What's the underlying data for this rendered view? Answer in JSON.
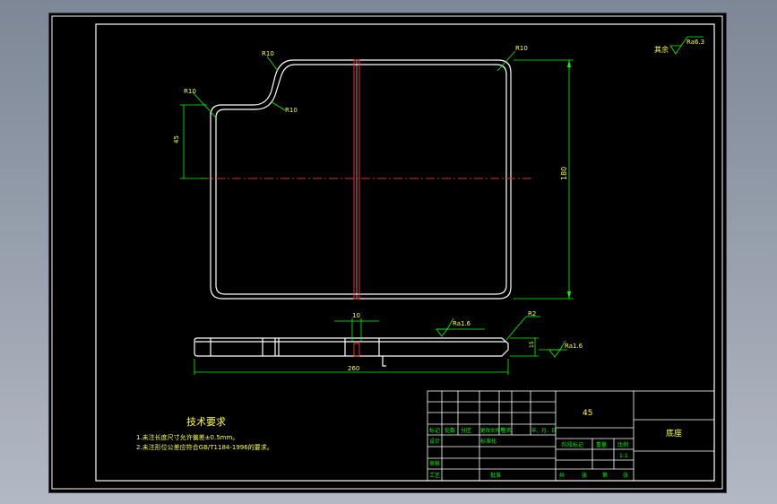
{
  "dimensions": {
    "r_top_left": "R10",
    "r_top_right": "R10",
    "r_notch_inner": "R10",
    "r_left_corner": "R10",
    "notch_depth": "45",
    "height": "180",
    "tab_width": "10",
    "roughness_top": "Ra1.6",
    "chamfer": "R2",
    "thickness": "15",
    "roughness_side": "Ra1.6",
    "length": "260",
    "roughness_general": "Ra6.3",
    "other_label": "其余"
  },
  "requirements": {
    "title": "技术要求",
    "item1": "1.未注长度尺寸允许偏差±0.5mm。",
    "item2": "2.未注形位公差应符合GB/T1184-1996的要求。"
  },
  "title_block": {
    "material": "45",
    "part_name": "底座",
    "scale": "1:1",
    "col_mark": "标记",
    "col_count": "处数",
    "col_zone": "分区",
    "col_docno": "更改文件号",
    "col_sign": "签名",
    "col_date": "年、月、日",
    "designer": "设计",
    "standardize": "标准化",
    "stage_mark": "阶段标记",
    "weight": "重量",
    "scale_label": "比例",
    "checker": "审核",
    "process": "工艺",
    "approve": "批准",
    "total": "共",
    "sheets": "张",
    "page": "第",
    "sheet": "张"
  }
}
